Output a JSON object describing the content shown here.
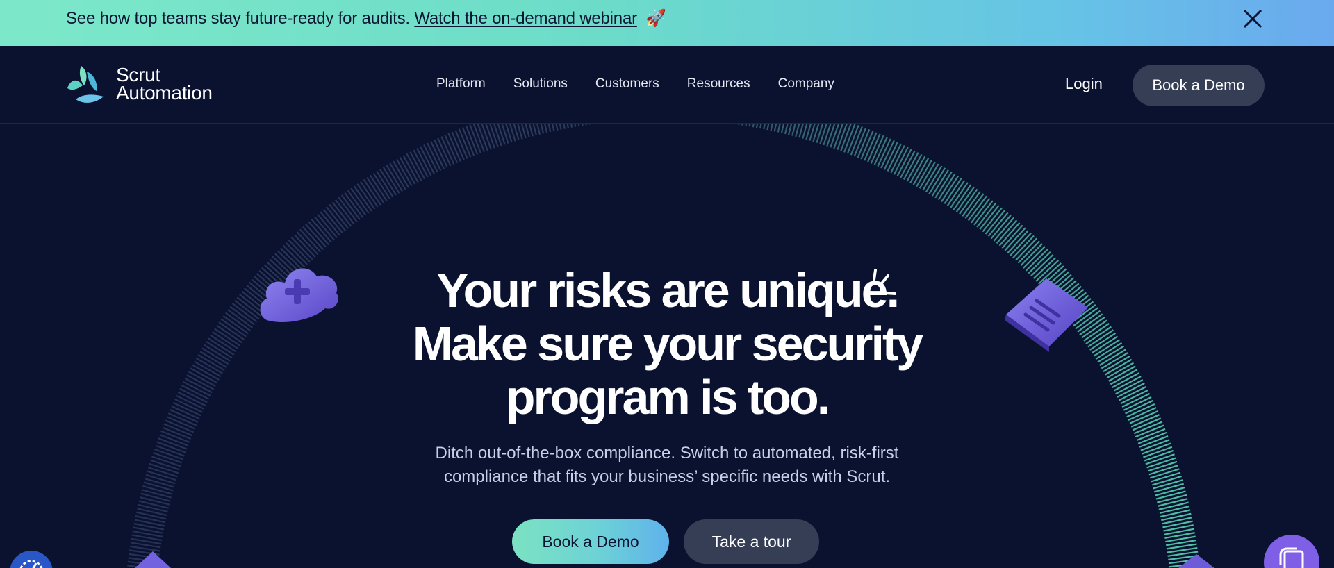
{
  "announcement": {
    "text": "See how top teams stay future-ready for audits.",
    "link_label": "Watch the on-demand webinar",
    "emoji": "🚀",
    "close_icon": "close-icon"
  },
  "nav": {
    "logo_line1": "Scrut",
    "logo_line2": "Automation",
    "links": [
      "Platform",
      "Solutions",
      "Customers",
      "Resources",
      "Company"
    ],
    "login_label": "Login",
    "demo_label": "Book a Demo"
  },
  "hero": {
    "headline_line1": "Your risks are unique.",
    "headline_line2": "Make sure your security",
    "headline_line3": "program is too.",
    "subtext_line1": "Ditch out-of-the-box compliance. Switch to automated, risk-first",
    "subtext_line2": "compliance that fits your business’ specific needs with Scrut.",
    "cta_primary": "Book a Demo",
    "cta_secondary": "Take a tour"
  },
  "colors": {
    "background": "#0a1230",
    "accent_teal": "#7be2c2",
    "accent_blue": "#5fb2ec",
    "button_dark": "#363e56",
    "icon_purple": "#7b6ee6"
  },
  "icons": [
    "cloud-plus-icon",
    "document-list-icon",
    "sparkle-icon",
    "widget-chart-icon",
    "widget-copy-icon"
  ]
}
